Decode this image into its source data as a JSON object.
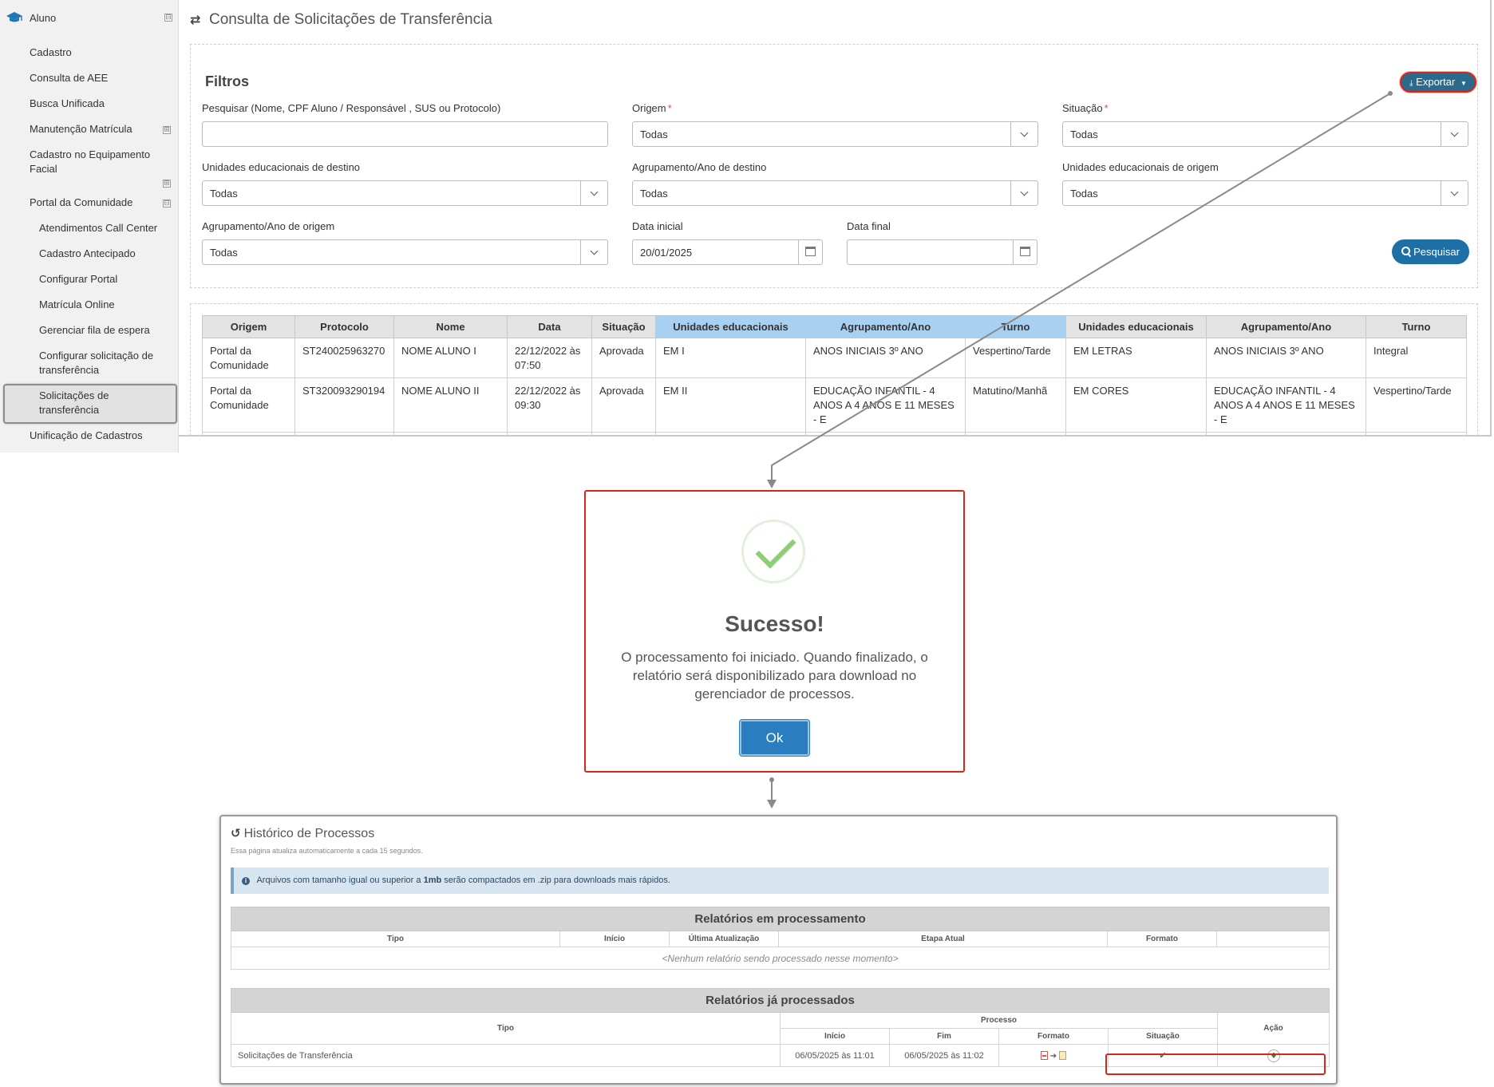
{
  "sidebar": {
    "section": "Aluno",
    "items": [
      {
        "label": "Cadastro"
      },
      {
        "label": "Consulta de AEE"
      },
      {
        "label": "Busca Unificada"
      },
      {
        "label": "Manutenção Matrícula"
      },
      {
        "label": "Cadastro no Equipamento Facial"
      },
      {
        "label": "Portal da Comunidade"
      },
      {
        "label": "Atendimentos Call Center"
      },
      {
        "label": "Cadastro Antecipado"
      },
      {
        "label": "Configurar Portal"
      },
      {
        "label": "Matrícula Online"
      },
      {
        "label": "Gerenciar fila de espera"
      },
      {
        "label": "Configurar solicitação de transferência"
      },
      {
        "label": "Solicitações de transferência"
      },
      {
        "label": "Unificação de Cadastros"
      }
    ],
    "toggles": {
      "collapse": "⊟",
      "expand": "⊞"
    }
  },
  "page": {
    "title": "Consulta de Solicitações de Transferência"
  },
  "filters": {
    "title": "Filtros",
    "export_label": "Exportar",
    "search_label": "Pesquisar (Nome, CPF Aluno / Responsável , SUS ou Protocolo)",
    "search_value": "",
    "origem_label": "Origem",
    "origem_value": "Todas",
    "situacao_label": "Situação",
    "situacao_value": "Todas",
    "required_mark": "*",
    "dest_units_label": "Unidades educacionais de destino",
    "dest_units_value": "Todas",
    "dest_group_label": "Agrupamento/Ano de destino",
    "dest_group_value": "Todas",
    "orig_units_label": "Unidades educacionais de origem",
    "orig_units_value": "Todas",
    "orig_group_label": "Agrupamento/Ano de origem",
    "orig_group_value": "Todas",
    "start_date_label": "Data inicial",
    "start_date_value": "20/01/2025",
    "end_date_label": "Data final",
    "end_date_value": "",
    "search_button": "Pesquisar"
  },
  "results": {
    "headers": [
      "Origem",
      "Protocolo",
      "Nome",
      "Data",
      "Situação",
      "Unidades educacionais",
      "Agrupamento/Ano",
      "Turno",
      "Unidades educacionais",
      "Agrupamento/Ano",
      "Turno"
    ],
    "rows": [
      [
        "Portal da Comunidade",
        "ST240025963270",
        "NOME ALUNO I",
        "22/12/2022 às 07:50",
        "Aprovada",
        "EM I",
        "ANOS INICIAIS 3º ANO",
        "Vespertino/Tarde",
        "EM LETRAS",
        "ANOS INICIAIS 3º ANO",
        "Integral"
      ],
      [
        "Portal da Comunidade",
        "ST320093290194",
        "NOME ALUNO II",
        "22/12/2022 às 09:30",
        "Aprovada",
        "EM II",
        "EDUCAÇÃO INFANTIL - 4 ANOS A 4 ANOS E 11 MESES - E",
        "Matutino/Manhã",
        "EM CORES",
        "EDUCAÇÃO INFANTIL - 4 ANOS A 4 ANOS E 11 MESES - E",
        "Vespertino/Tarde"
      ]
    ]
  },
  "dialog": {
    "title": "Sucesso!",
    "message": "O processamento foi iniciado. Quando finalizado, o relatório será disponibilizado para download no gerenciador de processos.",
    "ok_label": "Ok"
  },
  "history": {
    "title": "Histórico de Processos",
    "subtitle": "Essa página atualiza automaticamente a cada 15 segundos.",
    "info_prefix": "Arquivos com tamanho igual ou superior a",
    "info_bold": "1mb",
    "info_suffix": "serão compactados em .zip para downloads mais rápidos.",
    "processing": {
      "caption": "Relatórios em processamento",
      "headers": [
        "Tipo",
        "Início",
        "Última Atualização",
        "Etapa Atual",
        "Formato",
        ""
      ],
      "empty": "<Nenhum relatório sendo processado nesse momento>"
    },
    "processed": {
      "caption": "Relatórios já processados",
      "tipo_header": "Tipo",
      "processo_header": "Processo",
      "acao_header": "Ação",
      "sub_headers": [
        "Início",
        "Fim",
        "Formato",
        "Situação"
      ],
      "rows": [
        {
          "tipo": "Solicitações de Transferência",
          "inicio": "06/05/2025 às 11:01",
          "fim": "06/05/2025 às 11:02",
          "arrow": "➔"
        }
      ]
    }
  }
}
